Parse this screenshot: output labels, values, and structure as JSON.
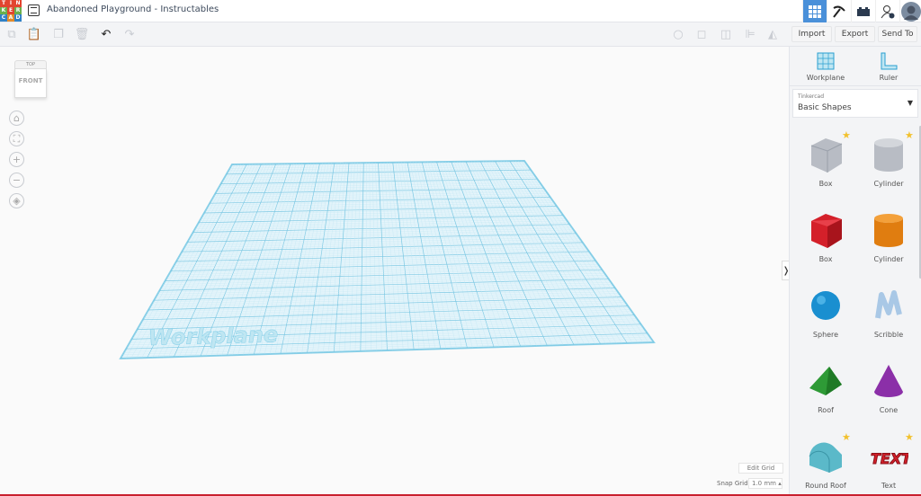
{
  "app": {
    "logo_letters": [
      "T",
      "I",
      "N",
      "K",
      "E",
      "R",
      "C",
      "A",
      "D"
    ],
    "logo_colors": [
      "#e2442f",
      "#e2442f",
      "#e2442f",
      "#6ab04c",
      "#e2442f",
      "#6ab04c",
      "#2f80c6",
      "#e38b2a",
      "#2f80c6"
    ],
    "title": "Abandoned Playground - Instructables"
  },
  "header": {
    "icons": [
      "grid-view-icon",
      "pickaxe-icon",
      "brick-icon",
      "add-user-icon",
      "avatar"
    ]
  },
  "toolbar": {
    "import": "Import",
    "export": "Export",
    "send_to": "Send To"
  },
  "viewcube": {
    "top": "TOP",
    "front": "FRONT"
  },
  "workplane": {
    "label": "Workplane"
  },
  "grid": {
    "edit_grid": "Edit Grid",
    "snap_label": "Snap Grid",
    "snap_value": "1.0 mm"
  },
  "sidebar": {
    "workplane": "Workplane",
    "ruler": "Ruler",
    "library_small": "Tinkercad",
    "library": "Basic Shapes",
    "shapes": [
      {
        "label": "Box",
        "star": true
      },
      {
        "label": "Cylinder",
        "star": true
      },
      {
        "label": "Box",
        "star": false
      },
      {
        "label": "Cylinder",
        "star": false
      },
      {
        "label": "Sphere",
        "star": false
      },
      {
        "label": "Scribble",
        "star": false
      },
      {
        "label": "Roof",
        "star": false
      },
      {
        "label": "Cone",
        "star": false
      },
      {
        "label": "Round Roof",
        "star": true
      },
      {
        "label": "Text",
        "star": true
      }
    ],
    "shape_text": "TEXT"
  },
  "colors": {
    "accent": "#4a90d9",
    "grid": "#8fd3ea"
  }
}
